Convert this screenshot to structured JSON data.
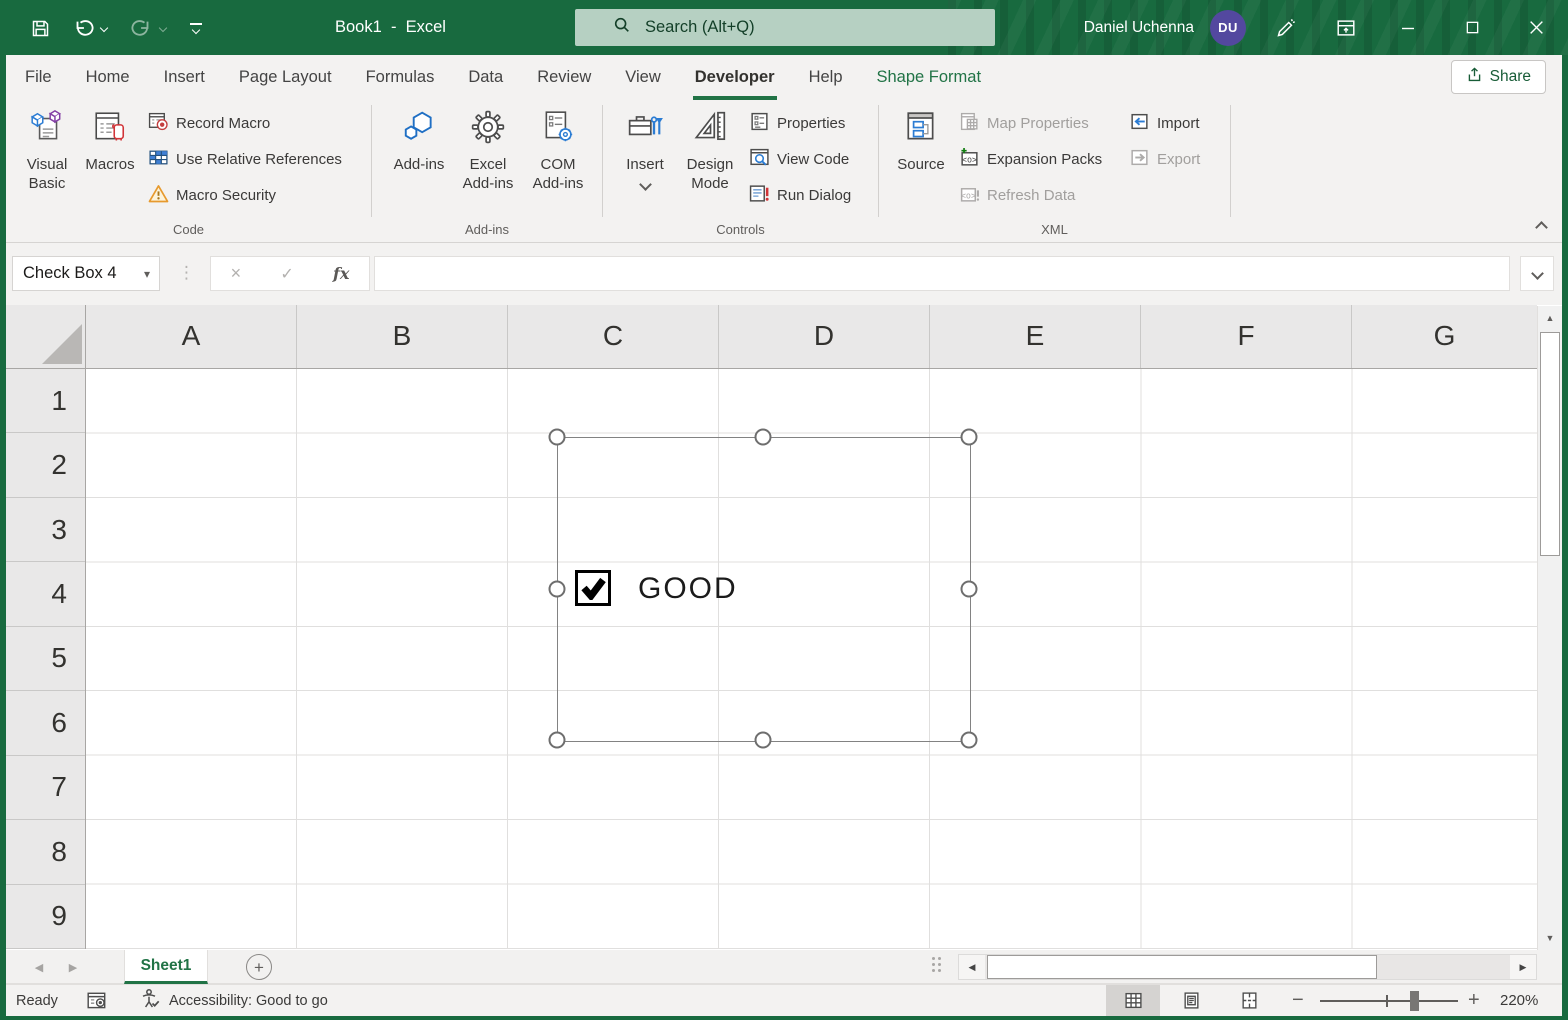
{
  "titlebar": {
    "title": "Book1  -  Excel",
    "search_placeholder": "Search (Alt+Q)",
    "user_name": "Daniel Uchenna",
    "user_initials": "DU"
  },
  "tabs": {
    "active": "Developer",
    "items": [
      "File",
      "Home",
      "Insert",
      "Page Layout",
      "Formulas",
      "Data",
      "Review",
      "View",
      "Developer",
      "Help",
      "Shape Format"
    ]
  },
  "share": {
    "label": "Share"
  },
  "ribbon": {
    "code": {
      "group_label": "Code",
      "visual_basic": "Visual Basic",
      "macros": "Macros",
      "record_macro": "Record Macro",
      "use_relative_references": "Use Relative References",
      "macro_security": "Macro Security"
    },
    "addins": {
      "group_label": "Add-ins",
      "addins": "Add-ins",
      "excel_addins": "Excel Add-ins",
      "com_addins": "COM Add-ins"
    },
    "controls": {
      "group_label": "Controls",
      "insert": "Insert",
      "design_mode": "Design Mode",
      "properties": "Properties",
      "view_code": "View Code",
      "run_dialog": "Run Dialog"
    },
    "xml": {
      "group_label": "XML",
      "source": "Source",
      "map_properties": "Map Properties",
      "expansion_packs": "Expansion Packs",
      "refresh_data": "Refresh Data",
      "import": "Import",
      "export": "Export"
    }
  },
  "formula_bar": {
    "name_box_value": "Check Box 4",
    "fx_label": "fx"
  },
  "grid": {
    "columns": [
      "A",
      "B",
      "C",
      "D",
      "E",
      "F",
      "G"
    ],
    "rows": [
      "1",
      "2",
      "3",
      "4",
      "5",
      "6",
      "7",
      "8",
      "9"
    ]
  },
  "sheet_object": {
    "checkbox_label": "GOOD",
    "checked": true
  },
  "sheet_bar": {
    "active_tab": "Sheet1"
  },
  "status_bar": {
    "mode": "Ready",
    "accessibility": "Accessibility: Good to go",
    "zoom_level": "220%"
  },
  "glyphs": {
    "dropdown": "▾",
    "up": "▲",
    "down": "▼",
    "left": "◀",
    "right": "▶",
    "cancel": "×",
    "check": "✓",
    "dots_v": "⋮",
    "plus": "+",
    "minus": "−"
  },
  "colors": {
    "titlebar_green": "#186a3f",
    "accent_green": "#217346",
    "avatar_purple": "#53489f",
    "search_box_green": "#b6d0c2",
    "disabled_text": "#a19f9d",
    "record_red": "#c43e3e",
    "icon_blue": "#2b7cd3",
    "warning_orange": "#e79a2e"
  }
}
